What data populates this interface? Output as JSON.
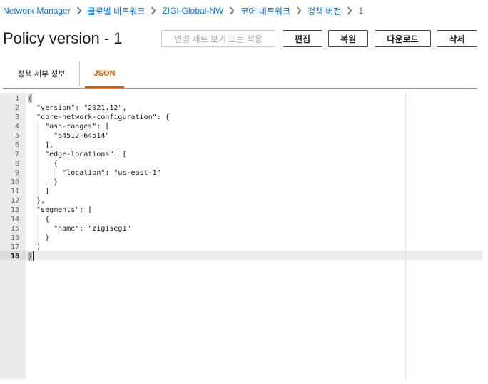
{
  "breadcrumb": {
    "items": [
      {
        "label": "Network Manager",
        "link": true
      },
      {
        "label": "글로벌 네트워크",
        "link": true
      },
      {
        "label": "ZIGI-Global-NW",
        "link": true
      },
      {
        "label": "코어 네트워크",
        "link": true
      },
      {
        "label": "정책 버전",
        "link": true
      },
      {
        "label": "1",
        "link": false
      }
    ]
  },
  "header": {
    "title": "Policy version - 1",
    "buttons": {
      "view_change_set": "변경 세트 보기 또는 적용",
      "edit": "편집",
      "restore": "복원",
      "download": "다운로드",
      "delete": "삭제"
    }
  },
  "tabs": [
    {
      "label": "정책 세부 정보",
      "active": false
    },
    {
      "label": "JSON",
      "active": true
    }
  ],
  "editor": {
    "active_line": 18,
    "lines": [
      "{",
      "  \"version\": \"2021.12\",",
      "  \"core-network-configuration\": {",
      "    \"asn-ranges\": [",
      "      \"64512-64514\"",
      "    ],",
      "    \"edge-locations\": [",
      "      {",
      "        \"location\": \"us-east-1\"",
      "      }",
      "    ]",
      "  },",
      "  \"segments\": [",
      "    {",
      "      \"name\": \"zigiseg1\"",
      "    }",
      "  ]",
      "}"
    ],
    "line_numbers": [
      "1",
      "2",
      "3",
      "4",
      "5",
      "6",
      "7",
      "8",
      "9",
      "10",
      "11",
      "12",
      "13",
      "14",
      "15",
      "16",
      "17",
      "18"
    ]
  },
  "colors": {
    "link": "#0972d3",
    "active_tab": "#d45b07",
    "gutter_bg": "#ebebeb",
    "button_border": "#414d5c"
  }
}
